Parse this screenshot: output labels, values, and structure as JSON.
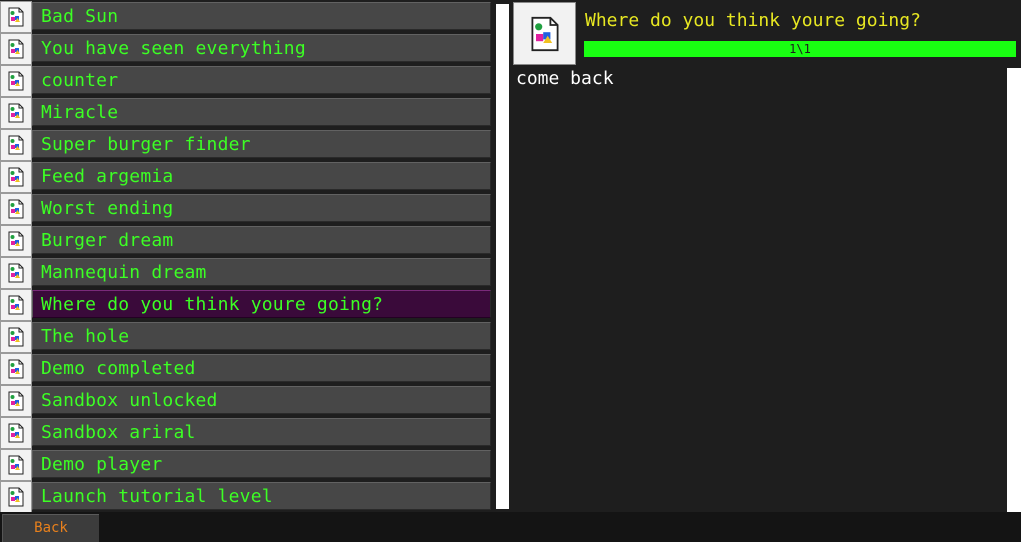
{
  "achievements": {
    "items": [
      {
        "label": "Bad Sun",
        "selected": false
      },
      {
        "label": "You have seen everything",
        "selected": false
      },
      {
        "label": "counter",
        "selected": false
      },
      {
        "label": "Miracle",
        "selected": false
      },
      {
        "label": "Super burger finder",
        "selected": false
      },
      {
        "label": "Feed argemia",
        "selected": false
      },
      {
        "label": "Worst ending",
        "selected": false
      },
      {
        "label": "Burger dream",
        "selected": false
      },
      {
        "label": "Mannequin dream",
        "selected": false
      },
      {
        "label": "Where do you think youre going?",
        "selected": true
      },
      {
        "label": "The hole",
        "selected": false
      },
      {
        "label": "Demo completed",
        "selected": false
      },
      {
        "label": "Sandbox unlocked",
        "selected": false
      },
      {
        "label": "Sandbox ariral",
        "selected": false
      },
      {
        "label": "Demo player",
        "selected": false
      },
      {
        "label": "Launch tutorial level",
        "selected": false
      }
    ],
    "icon": "missing-image-icon"
  },
  "detail": {
    "title": "Where do you think youre going?",
    "progress_text": "1\\1",
    "progress_fraction": 1.0,
    "description": "come back",
    "icon": "missing-image-icon"
  },
  "footer": {
    "back_label": "Back"
  },
  "colors": {
    "item_text": "#3cff24",
    "title_text": "#e8e822",
    "progress_fill": "#19ff12",
    "selected_bg": "#3a0a3a",
    "back_text": "#e8801c"
  }
}
